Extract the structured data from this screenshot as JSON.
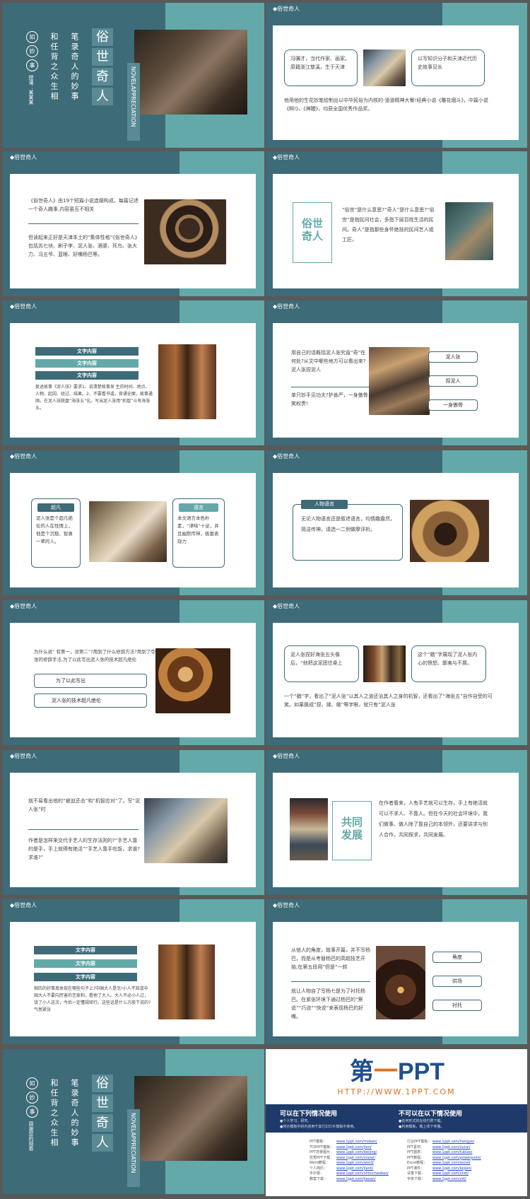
{
  "s1": {
    "circles": [
      "如",
      "妙",
      "事"
    ],
    "side": "授课：某某某",
    "col1": "和任背之众生相",
    "col2": "笔录奇人的妙事",
    "title": [
      "俗",
      "世",
      "奇",
      "人"
    ],
    "en": "NOVELAPPRECIATION"
  },
  "s2": {
    "hdr": "◆俗世奇人",
    "left": "冯骥才，当代作家、画家。原籍浙江慈溪，生于天津",
    "right": "以写知识分子和天津近代历史故事见长",
    "body": "他用他的生花妙笔绘制出以中华民俗为内核的-道道精神大餐!经典小说《雕花烟斗》，中篇小说《啊!》、《神鞭》，均获全国优秀作品奖。"
  },
  "s3": {
    "hdr": "◆俗世奇人",
    "t1": "《俗世奇人》由19个短篇小说连缀构成，每篇记述一个奇人趣事,内容虽互不相关",
    "t2": "但读起来正好是天津本土的“集体性格”《俗世奇人》包括苏七块、刷子李、泥人张、酒婆、死鸟、张大力、冯五爷、蓝眼、好嘴杨巴等。"
  },
  "s4": {
    "hdr": "◆俗世奇人",
    "box": "俗世奇人",
    "body": "“俗世”是什么意思?“奇人”是什么意思?“俗世”是指民间社会，多指下层百姓生活的民间。奇人”是指那些身怀绝技的民间艺人或工匠。"
  },
  "s5": {
    "hdr": "◆俗世奇人",
    "bars": [
      "文字内容",
      "文字内容",
      "文字内容"
    ],
    "body": "复述故事《泥人张》要求1、说清楚故事发 生的时间、地点、人物、起因、经过、结果。2、不要看书或，背诵全面，故事通顺。在泥人张脱盘“海张五”化。写出泥人张用“机智”斗有海张五。"
  },
  "s6": {
    "hdr": "◆俗世奇人",
    "t1": "用自己的话概括泥人张究竟“奇”在何处?从文中哪些地方可以看出来?泥人张捏泥人",
    "t2": "单只妙手见功夫?护善严，一身傲骨笑权贵!",
    "buttons": [
      "泥人张",
      "捏泥人",
      "一身傲骨"
    ]
  },
  "s7": {
    "hdr": "◆俗世奇人",
    "card1_title": "超凡",
    "card1_body": "泥人张是个超凡绝伦的人在性情上，他是个沉稳、智勇一辈的人。",
    "card2_title": "语言",
    "card2_body": "本文语言本色朴素，“津味”十足，并且幽默传神，极富表现力"
  },
  "s8": {
    "hdr": "◆俗世奇人",
    "tab": "人物语言",
    "body": "无论人物语言还是叙述语言，均情趣盎然，简洁传神。请选一二例做摩评析。"
  },
  "s9": {
    "hdr": "◆俗世奇人",
    "body": "为什么说“ 有第一，没第二”?用到了什么修辞方法?用到了夸张的修辞手法,为了以此写出泥人张的技术超凡绝伦",
    "box1": "为了以此写出",
    "box2": "泥人张的技术超凡绝伦"
  },
  "s10": {
    "hdr": "◆俗世奇人",
    "left": "泥人张捏好海张五头像后，“他把这泥团往桌上",
    "right": "这个“戳”字展现了泥人张内心的愤怒、鄙夷与不屑。",
    "body": "一个“戳”字，看出了“泥人张”以其人之道还治其人之身的机智，还看出了“海张五”自作自受的可笑。如果换成“捏、揉、做”等字眼，就只有“泥人张"
  },
  "s11": {
    "hdr": "◆俗世奇人",
    "t1": "就不易看出他的“被迫还击”和“机智应对”了。写“泥人张”时",
    "t2": "作者是怎样来交代手艺人的生存法则的?“手艺人靠的是手，手上就得有绝活”“手艺人靠手吃饭，求谁?求谁?”"
  },
  "s12": {
    "hdr": "◆俗世奇人",
    "box": "共同发展",
    "body": "在作者看来，人有手艺就可以生存，手上有绝活就可以不求人、不靠人。但在今天的社会环境中，我们做事、做人除了靠自己的本领外，还要讲求与别人合作，共同探求，共同发展。"
  },
  "s13": {
    "hdr": "◆俗世奇人",
    "bars": [
      "文字内容",
      "文字内容",
      "文字内容"
    ],
    "body": "相匹的好事真体现在哪些句子上?中国大人是怎!小人不知道中国大人不要向厉害的艺家和，看他了大人。大人不必小人过，饶了小人这次，今后一定懂规矩行。这些话是什么方般下说的?气氛紧张"
  },
  "s14": {
    "hdr": "◆俗世奇人",
    "t1": "从他人的角度，故事开篇，并不写杨巴，而是从考替杨巴的高超技艺开始;在第五段用“但是”一转",
    "t2": "就让人物自了写杨七是为了衬托杨巴。在紧张环境下通过杨巴的“察说”“巧说”“快说”来表现杨巴的好嘴。",
    "buttons": [
      "角度",
      "烘场",
      "衬托"
    ]
  },
  "s15": {
    "circles": [
      "如",
      "妙",
      "事"
    ],
    "side": "感谢您的观看",
    "col1": "和任背之众生相",
    "col2": "笔录奇人的妙事",
    "title": [
      "俗",
      "世",
      "奇",
      "人"
    ],
    "en": "NOVELAPPRECIATION"
  },
  "s16": {
    "logo_a": "第",
    "logo_b": "一",
    "logo_c": "PPT",
    "url": "HTTP://WWW.1PPT.COM",
    "left_title": "可以在下列情况使用",
    "left_items": [
      "●个人学习、研究。",
      "●将示模板中的内容用于其它幻灯片模板中使用。"
    ],
    "right_title": "不可以在以下情况使用",
    "right_items": [
      "●任何形式的在线付费下载。",
      "●利用模板，做上线下传播。"
    ],
    "links_left": [
      [
        "PPT模板：",
        "www.1ppt.com/moban/"
      ],
      [
        "节日PPT模板：",
        "www.1ppt.com/jieri/"
      ],
      [
        "PPT背景图片：",
        "www.1ppt.com/beijing/"
      ],
      [
        "优秀PPT下载：",
        "www.1ppt.com/xiazai/"
      ],
      [
        "Word教程：",
        "www.1ppt.com/word/"
      ],
      [
        "个人简历：",
        "www.1ppt.com/jianli/"
      ],
      [
        "手抄报：",
        "www.1ppt.com/shouchaobao/"
      ],
      [
        "教案下载：",
        "www.1ppt.com/jiaoan/"
      ]
    ],
    "links_right": [
      [
        "行业PPT模板：",
        "www.1ppt.com/hangye/"
      ],
      [
        "PPT素材：",
        "www.1ppt.com/sucai/"
      ],
      [
        "PPT图表：",
        "www.1ppt.com/tubiao/"
      ],
      [
        "PPT教程：",
        "www.1ppt.com/powerpoint/"
      ],
      [
        "Excel教程：",
        "www.1ppt.com/excel/"
      ],
      [
        "PPT课件：",
        "www.1ppt.com/kejian/"
      ],
      [
        "试卷下载：",
        "www.1ppt.com/shiti/"
      ],
      [
        "字体下载：",
        "www.1ppt.com/ziti/"
      ]
    ]
  }
}
